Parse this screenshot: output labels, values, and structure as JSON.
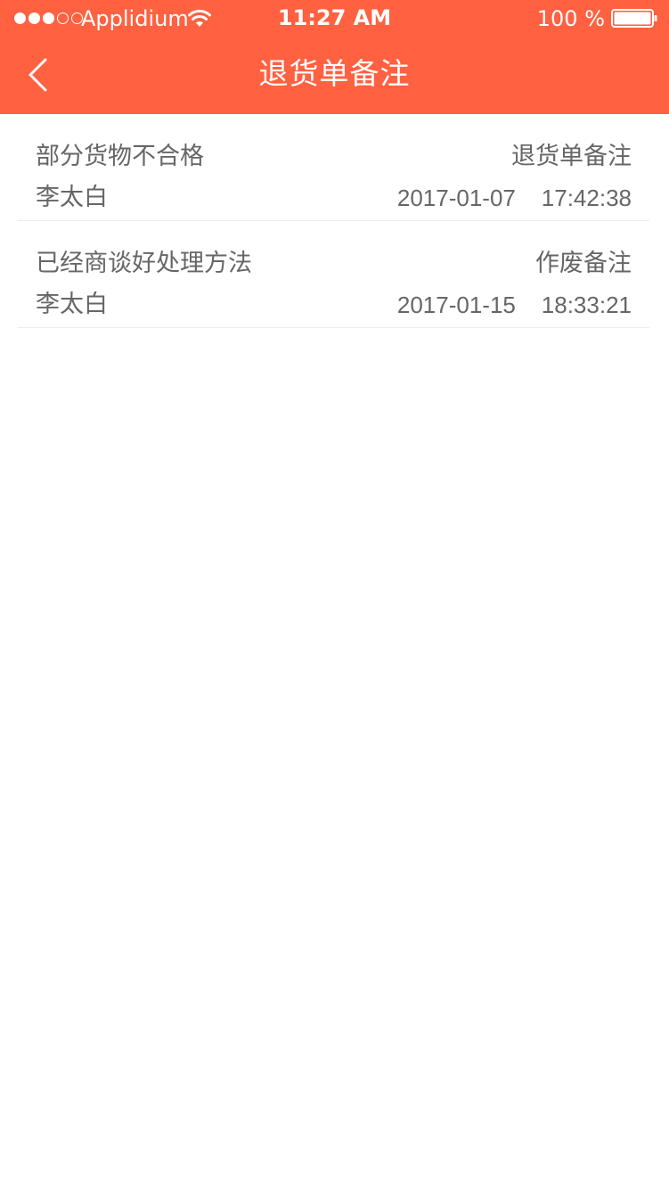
{
  "status_bar": {
    "carrier": "Applidium",
    "time": "11:27 AM",
    "battery": "100 %",
    "signal_dots_filled": 3,
    "signal_dots_total": 5
  },
  "nav": {
    "title": "退货单备注",
    "back_icon": "chevron-left-icon"
  },
  "colors": {
    "header_bg": "#ff6141",
    "text": "#666666",
    "divider": "#ececec"
  },
  "remarks": [
    {
      "content": "部分货物不合格",
      "type": "退货单备注",
      "author": "李太白",
      "datetime": "2017-01-07    17:42:38"
    },
    {
      "content": "已经商谈好处理方法",
      "type": "作废备注",
      "author": "李太白",
      "datetime": "2017-01-15    18:33:21"
    }
  ]
}
